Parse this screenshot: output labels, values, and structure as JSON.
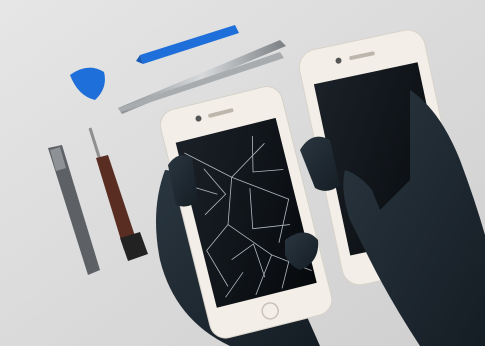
{
  "scene": {
    "background_color": "#dcdcdc",
    "accent_blue": "#1e6fd9",
    "glove_color": "#1e2a33",
    "phone_frame_color": "#f3efe8",
    "screen_color": "#0d1116"
  },
  "objects": [
    {
      "name": "blue-pry-tool",
      "icon": "pry-tool-icon"
    },
    {
      "name": "blue-guitar-pick",
      "icon": "pick-icon"
    },
    {
      "name": "tweezers",
      "icon": "tweezers-icon"
    },
    {
      "name": "spudger",
      "icon": "spudger-icon"
    },
    {
      "name": "screwdriver",
      "icon": "screwdriver-icon"
    },
    {
      "name": "cracked-phone",
      "icon": "cracked-phone-icon"
    },
    {
      "name": "intact-phone",
      "icon": "phone-icon"
    },
    {
      "name": "left-glove",
      "icon": "glove-icon"
    },
    {
      "name": "right-glove",
      "icon": "glove-icon"
    }
  ]
}
